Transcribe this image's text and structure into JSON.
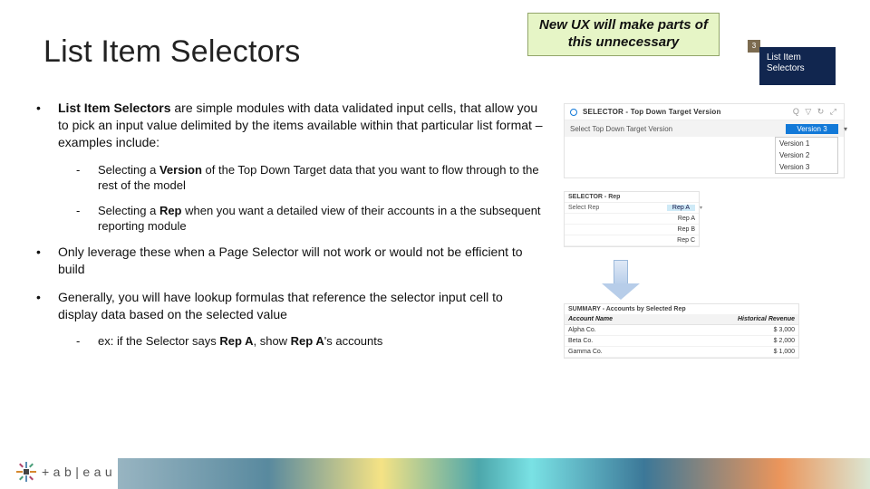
{
  "title": "List Item Selectors",
  "callout": "New UX will make parts of this unnecessary",
  "tag": {
    "num": "3",
    "label": "List Item\nSelectors"
  },
  "bullets": {
    "b1_pre": "List Item Selectors",
    "b1_post": " are simple modules with data validated input cells, that allow you to pick an input value delimited by the items available within that particular list format – examples include:",
    "b1a_pre": "Selecting a ",
    "b1a_bold": "Version",
    "b1a_post": " of the Top Down Target data that you want to flow through to the rest of the model",
    "b1b_pre": "Selecting a ",
    "b1b_bold": "Rep",
    "b1b_post": " when you want a detailed view of their accounts in a the subsequent reporting module",
    "b2": "Only leverage these when a Page Selector will not work or would not be efficient to build",
    "b3": "Generally, you will have lookup formulas that reference the selector input cell to display data based on the selected value",
    "b3a_pre": "ex: if the Selector says ",
    "b3a_bold1": "Rep A",
    "b3a_mid": ", show ",
    "b3a_bold2": "Rep A",
    "b3a_post": "'s accounts"
  },
  "fig1": {
    "title": "SELECTOR - Top Down Target Version",
    "icons": "Q ▽ ↻ ⤢",
    "row_label": "Select Top Down Target Version",
    "selected": "Version 3",
    "options": [
      "Version 1",
      "Version 2",
      "Version 3"
    ]
  },
  "fig2": {
    "title": "SELECTOR - Rep",
    "row_label": "Select Rep",
    "selected": "Rep A",
    "rows": [
      "Rep A",
      "Rep B",
      "Rep C"
    ]
  },
  "fig3": {
    "title": "SUMMARY - Accounts by Selected Rep",
    "col1": "Account Name",
    "col2": "Historical Revenue",
    "rows": [
      {
        "name": "Alpha Co.",
        "rev": "$ 3,000"
      },
      {
        "name": "Beta Co.",
        "rev": "$ 2,000"
      },
      {
        "name": "Gamma Co.",
        "rev": "$ 1,000"
      }
    ]
  },
  "brand": "+ a b | e a u"
}
